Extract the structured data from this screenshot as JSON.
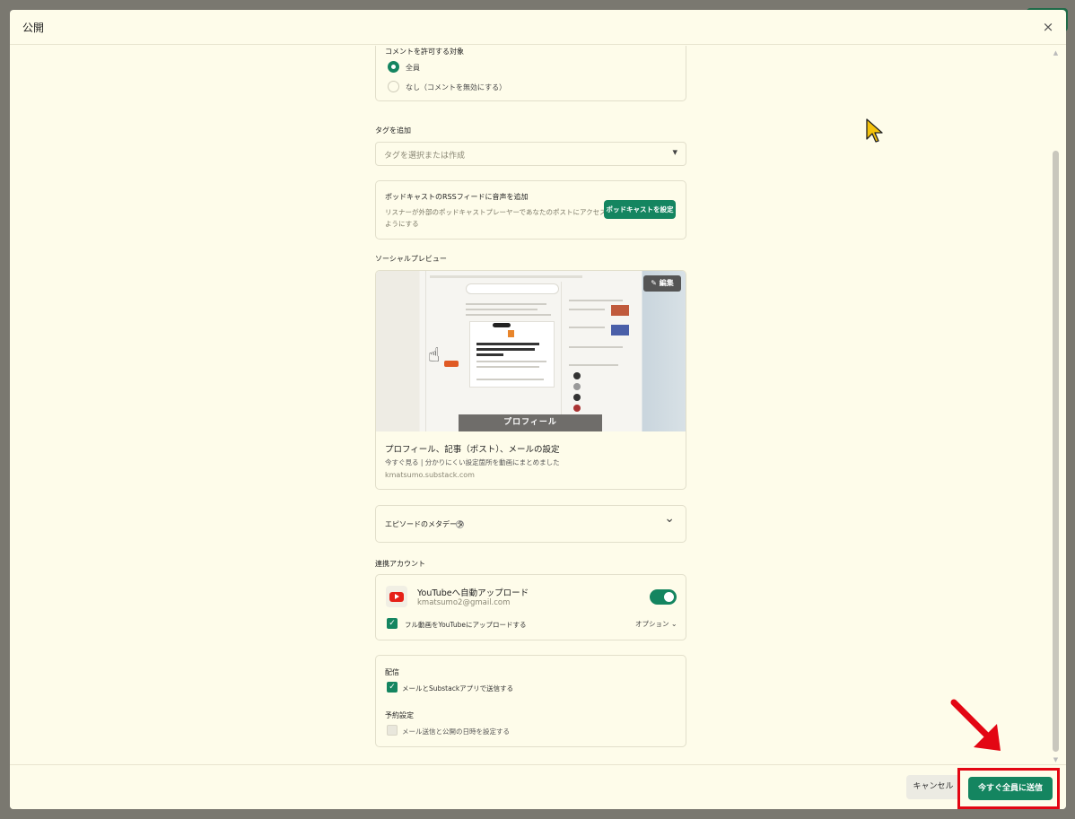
{
  "modal": {
    "title": "公開",
    "close_icon": "×"
  },
  "comments": {
    "title": "コメントを許可する対象",
    "options": [
      {
        "label": "全員",
        "selected": true
      },
      {
        "label": "なし（コメントを無効にする）",
        "selected": false
      }
    ]
  },
  "tags": {
    "label": "タグを追加",
    "placeholder": "タグを選択または作成",
    "arrow": "▾"
  },
  "podcast_rss": {
    "title": "ポッドキャストのRSSフィードに音声を追加",
    "description_line1": "リスナーが外部のポッドキャストプレーヤーであなたのポストにアクセスできる",
    "description_line2": "ようにする",
    "button": "ポッドキャストを設定"
  },
  "social_preview": {
    "label": "ソーシャルプレビュー",
    "edit_button": "編集",
    "image_banner": "プロフィール",
    "title": "プロフィール、記事（ポスト）、メールの設定",
    "subtitle": "今すぐ見る | 分かりにくい設定箇所を動画にまとめました",
    "domain": "kmatsumo.substack.com"
  },
  "episode_metadata": {
    "label": "エピソードのメタデータ",
    "help_icon": "?",
    "chevron": "⌄"
  },
  "linked_accounts": {
    "label": "連携アカウント",
    "youtube": {
      "title": "YouTubeへ自動アップロード",
      "email": "kmatsumo2@gmail.com",
      "toggle_on": true,
      "checkbox_label": "フル動画をYouTubeにアップロードする",
      "checkbox_checked": true,
      "options_label": "オプション"
    }
  },
  "delivery": {
    "title": "配信",
    "send_label": "メールとSubstackアプリで送信する",
    "send_checked": true,
    "schedule_title": "予約設定",
    "schedule_label": "メール送信と公開の日時を設定する",
    "schedule_checked": false
  },
  "footer": {
    "cancel": "キャンセル",
    "send_now": "今すぐ全員に送信"
  },
  "colors": {
    "accent": "#148560",
    "highlight": "#e30613",
    "background": "#fefcea"
  }
}
